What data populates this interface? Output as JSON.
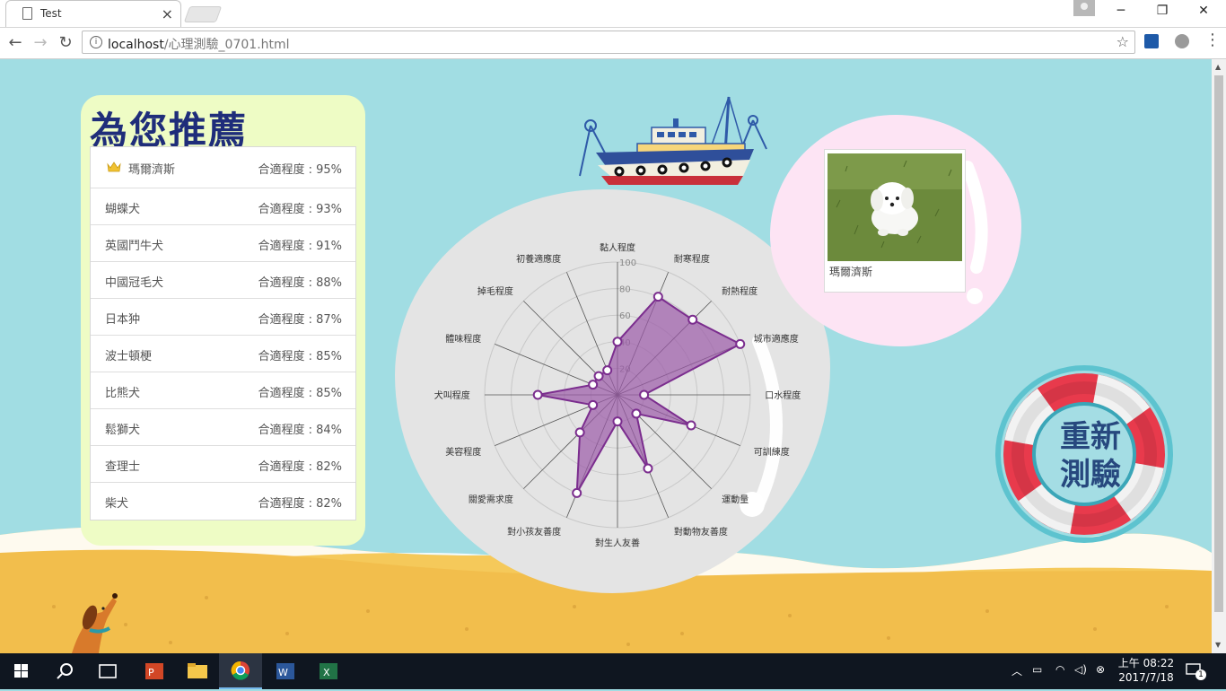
{
  "browser": {
    "tab_title": "Test",
    "url_host": "localhost",
    "url_path": "/心理測驗_0701.html"
  },
  "recommend": {
    "title": "為您推薦",
    "items": [
      {
        "name": "瑪爾濟斯",
        "score": "合適程度 : 95%"
      },
      {
        "name": "蝴蝶犬",
        "score": "合適程度 : 93%"
      },
      {
        "name": "英國鬥牛犬",
        "score": "合適程度 : 91%"
      },
      {
        "name": "中國冠毛犬",
        "score": "合適程度 : 88%"
      },
      {
        "name": "日本狆",
        "score": "合適程度 : 87%"
      },
      {
        "name": "波士頓梗",
        "score": "合適程度 : 85%"
      },
      {
        "name": "比熊犬",
        "score": "合適程度 : 85%"
      },
      {
        "name": "鬆獅犬",
        "score": "合適程度 : 84%"
      },
      {
        "name": "查理士",
        "score": "合適程度 : 82%"
      },
      {
        "name": "柴犬",
        "score": "合適程度 : 82%"
      }
    ]
  },
  "chart_data": {
    "type": "radar",
    "categories": [
      "黏人程度",
      "耐寒程度",
      "耐熱程度",
      "城市適應度",
      "口水程度",
      "可訓練度",
      "運動量",
      "對動物友善度",
      "對生人友善",
      "對小孩友善度",
      "關愛需求度",
      "美容程度",
      "犬叫程度",
      "體味程度",
      "掉毛程度",
      "初養適應度"
    ],
    "values": [
      40,
      80,
      80,
      100,
      20,
      60,
      20,
      60,
      20,
      80,
      40,
      20,
      60,
      20,
      20,
      20
    ],
    "scale_ticks": [
      "20",
      "40",
      "60",
      "80",
      "100"
    ],
    "range": [
      0,
      100
    ],
    "fill_color": "#9b5aa8",
    "line_color": "#7b2d8e"
  },
  "photo": {
    "caption": "瑪爾濟斯"
  },
  "retake_button": {
    "line1": "重新",
    "line2": "測驗"
  },
  "taskbar": {
    "time": "上午 08:22",
    "date": "2017/7/18",
    "notification_count": "1"
  }
}
